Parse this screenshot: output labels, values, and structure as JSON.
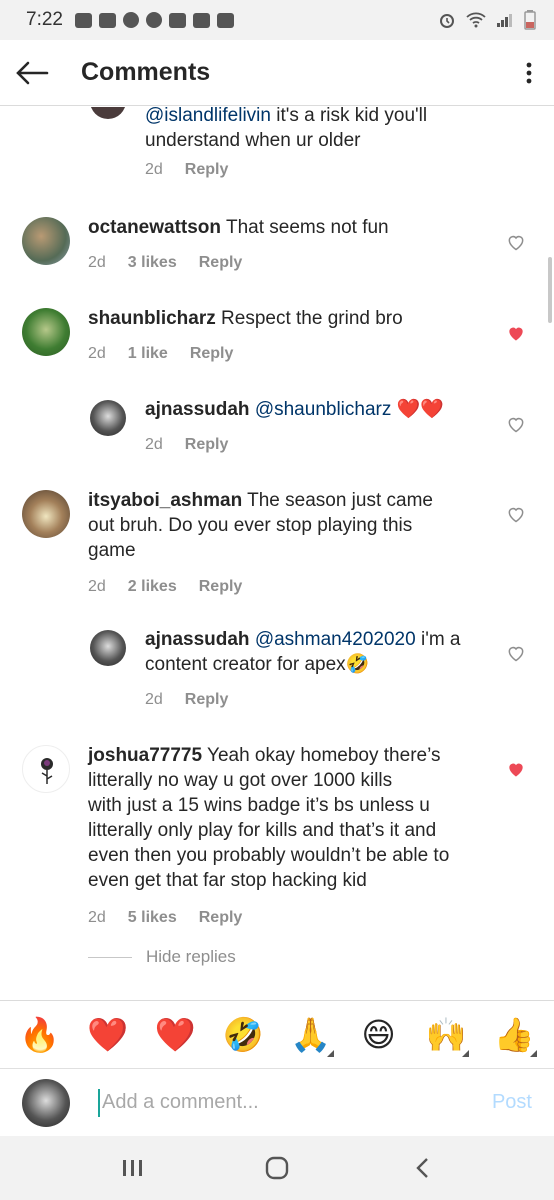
{
  "status_bar": {
    "time": "7:22"
  },
  "header": {
    "title": "Comments"
  },
  "comments": [
    {
      "id": "top-reply",
      "mention": "@islandlifelivin",
      "text_line1": " it's a risk kid you'll",
      "text_line2": "understand when ur older",
      "time": "2d",
      "reply": "Reply"
    },
    {
      "id": "octane",
      "username": "octanewattson",
      "text": " That seems not fun",
      "time": "2d",
      "likes": "3 likes",
      "reply": "Reply",
      "liked": false
    },
    {
      "id": "shaun",
      "username": "shaunblicharz",
      "text": " Respect the grind bro",
      "time": "2d",
      "likes": "1 like",
      "reply": "Reply",
      "liked": true
    },
    {
      "id": "ajn1",
      "username": "ajnassudah",
      "mention": " @shaunblicharz",
      "text": " ❤️❤️",
      "time": "2d",
      "reply": "Reply",
      "liked": false
    },
    {
      "id": "ashman",
      "username": "itsyaboi_ashman",
      "text_line1": " The season just came",
      "text_line2": "out bruh. Do you ever stop playing this",
      "text_line3": "game",
      "time": "2d",
      "likes": "2 likes",
      "reply": "Reply",
      "liked": false
    },
    {
      "id": "ajn2",
      "username": "ajnassudah",
      "mention": " @ashman4202020",
      "text_line1": " i'm a",
      "text_line2": "content creator for apex🤣",
      "time": "2d",
      "reply": "Reply",
      "liked": false
    },
    {
      "id": "joshua",
      "username": "joshua77775",
      "text_line1": " Yeah okay homeboy there’s",
      "text_line2": "litterally no way u got over 1000 kills",
      "text_line3": "with just a 15 wins badge it’s bs unless u",
      "text_line4": "litterally only play for kills and that’s it and",
      "text_line5": "even then you probably wouldn’t be able to",
      "text_line6": "even get that far stop hacking kid",
      "time": "2d",
      "likes": "5 likes",
      "reply": "Reply",
      "liked": true
    }
  ],
  "hide_replies": "Hide replies",
  "emoji_bar": [
    "🔥",
    "❤️",
    "❤️",
    "🤣",
    "🙏",
    "😄",
    "🙌",
    "👍"
  ],
  "composer": {
    "placeholder": "Add a comment...",
    "post": "Post"
  },
  "colors": {
    "like_red": "#ed4956",
    "mention_blue": "#003569",
    "post_disabled": "#b3dbff",
    "cursor_teal": "#1aa59a"
  }
}
